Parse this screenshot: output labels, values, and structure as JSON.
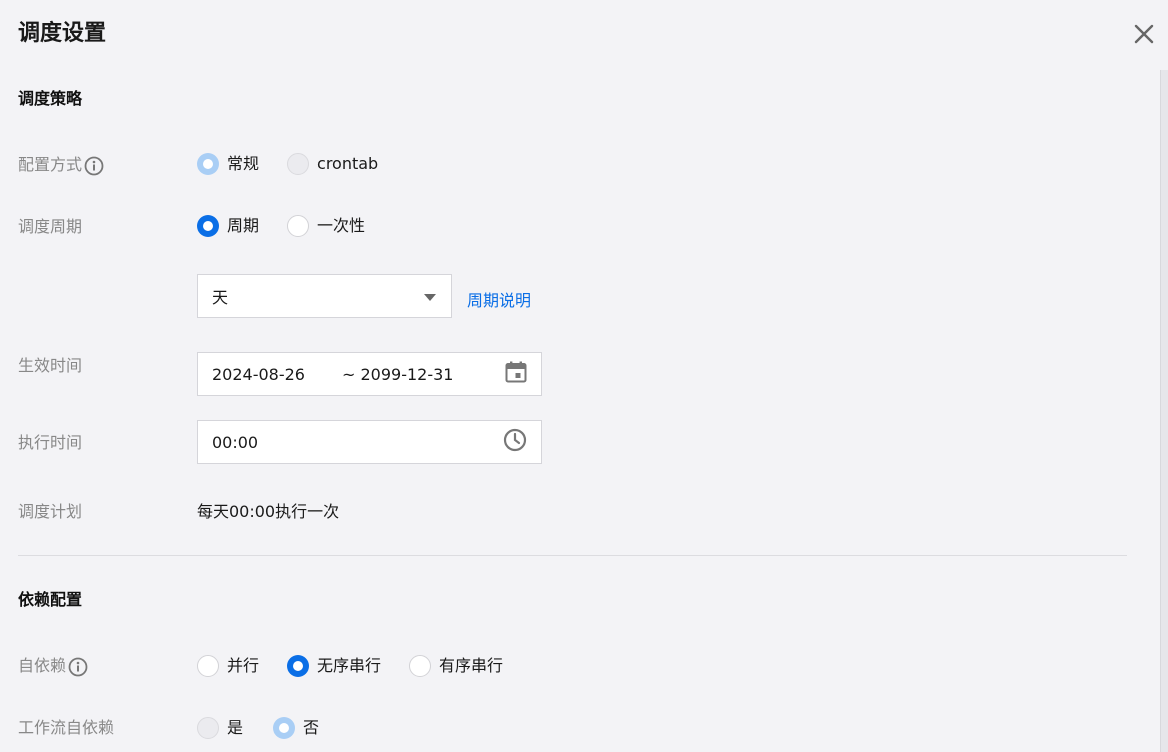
{
  "dialog": {
    "title": "调度设置"
  },
  "strategy": {
    "heading": "调度策略",
    "config_mode": {
      "label": "配置方式",
      "options": [
        "常规",
        "crontab"
      ]
    },
    "period": {
      "label": "调度周期",
      "options": [
        "周期",
        "一次性"
      ]
    },
    "period_select": {
      "value": "天",
      "help_link": "周期说明"
    },
    "effective": {
      "label": "生效时间",
      "start": "2024-08-26",
      "end": "~ 2099-12-31"
    },
    "exec_time": {
      "label": "执行时间",
      "value": "00:00"
    },
    "plan": {
      "label": "调度计划",
      "value": "每天00:00执行一次"
    }
  },
  "dependency": {
    "heading": "依赖配置",
    "self_dep": {
      "label": "自依赖",
      "options": [
        "并行",
        "无序串行",
        "有序串行"
      ]
    },
    "workflow_dep": {
      "label": "工作流自依赖",
      "options": [
        "是",
        "否"
      ]
    }
  },
  "colors": {
    "accent": "#0a6ee6",
    "background": "#f3f3f6"
  },
  "icons": [
    "close-icon",
    "info-icon",
    "dropdown-arrow-icon",
    "calendar-icon",
    "clock-icon"
  ]
}
